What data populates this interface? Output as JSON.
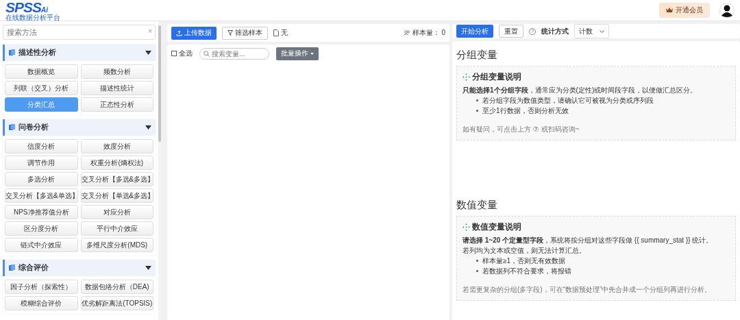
{
  "header": {
    "logo": "SPSS",
    "logo_suffix": "Ai",
    "logo_subtitle": "在线数据分析平台",
    "member_button": "开通会员"
  },
  "sidebar": {
    "search": {
      "placeholder": "搜索方法",
      "clear": "×"
    },
    "sections": [
      {
        "title": "描述性分析",
        "expanded": true,
        "items": [
          {
            "label": "数据概览",
            "selected": false
          },
          {
            "label": "频数分析",
            "selected": false
          },
          {
            "label": "列联（交叉）分析",
            "selected": false
          },
          {
            "label": "描述性统计",
            "selected": false
          },
          {
            "label": "分类汇总",
            "selected": true
          },
          {
            "label": "正态性分析",
            "selected": false
          }
        ]
      },
      {
        "title": "问卷分析",
        "expanded": true,
        "items": [
          {
            "label": "信度分析",
            "selected": false
          },
          {
            "label": "效度分析",
            "selected": false
          },
          {
            "label": "调节作用",
            "selected": false
          },
          {
            "label": "权重分析(熵权法)",
            "selected": false
          },
          {
            "label": "多选分析",
            "selected": false
          },
          {
            "label": "交叉分析【多选&多选】",
            "selected": false
          },
          {
            "label": "交叉分析【多选&单选】",
            "selected": false
          },
          {
            "label": "交叉分析【单选&多选】",
            "selected": false
          },
          {
            "label": "NPS净推荐值分析",
            "selected": false
          },
          {
            "label": "对应分析",
            "selected": false
          },
          {
            "label": "区分度分析",
            "selected": false
          },
          {
            "label": "平行中介效应",
            "selected": false
          },
          {
            "label": "链式中介效应",
            "selected": false
          },
          {
            "label": "多维尺度分析(MDS)",
            "selected": false
          }
        ]
      },
      {
        "title": "综合评价",
        "expanded": true,
        "items": [
          {
            "label": "因子分析（探索性）",
            "selected": false
          },
          {
            "label": "数据包络分析（DEA)",
            "selected": false
          },
          {
            "label": "模糊综合评价",
            "selected": false
          },
          {
            "label": "优劣解距离法(TOPSIS)",
            "selected": false
          }
        ]
      }
    ]
  },
  "data_panel": {
    "upload_button": "上传数据",
    "filter_button": "筛选样本",
    "file_name": "无",
    "sample_label": "样本量：",
    "sample_count": "0",
    "select_all": {
      "label": "全选",
      "checked": false
    },
    "variable_search": {
      "placeholder": "搜索变量..."
    },
    "batch_button": "批量操作"
  },
  "analysis_panel": {
    "start_button": "开始分析",
    "reset_button": "重置",
    "help": "?",
    "stat_method_label": "统计方式",
    "stat_method_value": "计数",
    "sections": [
      {
        "heading": "分组变量",
        "note_title": "分组变量说明",
        "paragraphs": [
          "**只能选择1个分组字段**，通常应为分类(定性)或时间段字段，以便做汇总区分。"
        ],
        "bullets": [
          "若分组字段为数值类型，请确认它可被视为分类或序列段",
          "至少1行数据，否则分析无效"
        ],
        "footer": "如有疑问，可点击上方 ⑦ 或扫码咨询~"
      },
      {
        "heading": "数值变量",
        "note_title": "数值变量说明",
        "paragraphs": [
          "**请选择 1~20 个定量型字段**，系统将按分组对这些字段做 {{ summary_stat }} 统计。",
          "若列均为文本或空值，则无法计算汇总。"
        ],
        "bullets": [
          "样本量≥1，否则无有效数据",
          "若数据列不符合要求，将报错"
        ],
        "footer": "若需更复杂的分组(多字段)，可在“数据预处理”中先合并成一个分组列再进行分析。"
      }
    ]
  }
}
